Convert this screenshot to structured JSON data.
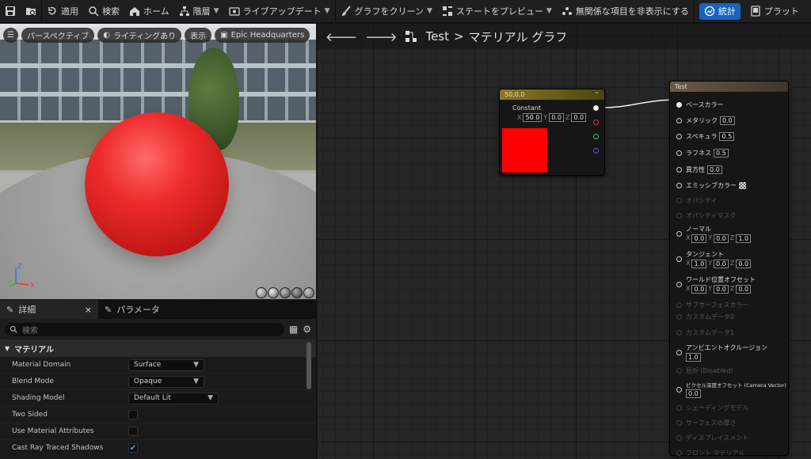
{
  "toolbar": {
    "items": [
      {
        "name": "save",
        "label": ""
      },
      {
        "name": "browse",
        "label": ""
      },
      {
        "name": "apply",
        "label": "適用"
      },
      {
        "name": "search",
        "label": "検索"
      },
      {
        "name": "home",
        "label": "ホーム"
      },
      {
        "name": "hierarchy",
        "label": "階層"
      },
      {
        "name": "live-update",
        "label": "ライブアップデート"
      },
      {
        "name": "clean-graph",
        "label": "グラフをクリーン"
      },
      {
        "name": "preview-state",
        "label": "ステートをプレビュー"
      },
      {
        "name": "hide-unrelated",
        "label": "無関係な項目を非表示にする"
      },
      {
        "name": "stats",
        "label": "統計"
      },
      {
        "name": "platform",
        "label": "プラット"
      }
    ]
  },
  "viewport": {
    "perspective": "パースペクティブ",
    "lighting": "ライティングあり",
    "show": "表示",
    "scene": "Epic Headquarters",
    "axes": {
      "x": "X",
      "y": "Y",
      "z": "Z"
    }
  },
  "details": {
    "tab_details": "詳細",
    "tab_params": "パラメータ",
    "search_placeholder": "検索",
    "section": "マテリアル",
    "props": [
      {
        "label": "Material Domain",
        "value": "Surface",
        "type": "dropdown"
      },
      {
        "label": "Blend Mode",
        "value": "Opaque",
        "type": "dropdown"
      },
      {
        "label": "Shading Model",
        "value": "Default Lit",
        "type": "dropdown"
      },
      {
        "label": "Two Sided",
        "value": "",
        "type": "check",
        "checked": false
      },
      {
        "label": "Use Material Attributes",
        "value": "",
        "type": "check",
        "checked": false
      },
      {
        "label": "Cast Ray Traced Shadows",
        "value": "",
        "type": "check",
        "checked": true
      }
    ]
  },
  "graph": {
    "breadcrumb_root": "Test",
    "breadcrumb_sep": ">",
    "breadcrumb_current": "マテリアル グラフ"
  },
  "constant_node": {
    "title": "50,0,0",
    "label": "Constant",
    "x_label": "X",
    "x": "50.0",
    "y_label": "Y",
    "y": "0.0",
    "z_label": "Z",
    "z": "0.0",
    "color": "#ff0000"
  },
  "result_node": {
    "title": "Test",
    "inputs": [
      {
        "label": "ベースカラー",
        "active": true
      },
      {
        "label": "メタリック",
        "active": true,
        "value": "0.0"
      },
      {
        "label": "スペキュラ",
        "active": true,
        "value": "0.5"
      },
      {
        "label": "ラフネス",
        "active": true,
        "value": "0.5"
      },
      {
        "label": "異方性",
        "active": true,
        "value": "0.0"
      },
      {
        "label": "エミッシブカラー",
        "active": true
      },
      {
        "label": "オパシティ",
        "active": false
      },
      {
        "label": "オパシティマスク",
        "active": false
      },
      {
        "label": "ノーマル",
        "active": true,
        "vec": [
          "0.0",
          "0.0",
          "1.0"
        ]
      },
      {
        "label": "タンジェント",
        "active": true,
        "vec": [
          "1.0",
          "0.0",
          "0.0"
        ]
      },
      {
        "label": "ワールド位置オフセット",
        "active": true,
        "vec": [
          "0.0",
          "0.0",
          "0.0"
        ]
      },
      {
        "label": "サブサーフェスカラー",
        "active": false
      },
      {
        "label": "カスタムデータ0",
        "active": false
      },
      {
        "label": "カスタムデータ1",
        "active": false
      },
      {
        "label": "アンビエントオクルージョン",
        "active": true,
        "value": "1.0"
      },
      {
        "label": "屈折 (Disabled)",
        "active": false
      },
      {
        "label": "ピクセル深度オフセット (Camera Vector)",
        "active": true,
        "value": "0.0"
      },
      {
        "label": "シェーディングモデル",
        "active": false
      },
      {
        "label": "サーフェスの厚さ",
        "active": false
      },
      {
        "label": "ディスプレイスメント",
        "active": false
      },
      {
        "label": "フロント マテリアル",
        "active": false
      }
    ],
    "vec_labels": [
      "X",
      "Y",
      "Z"
    ]
  },
  "colors": {
    "accent": "#1565c0",
    "node_header_constant": "#8a7a1e",
    "node_header_result": "#6b5a45"
  }
}
